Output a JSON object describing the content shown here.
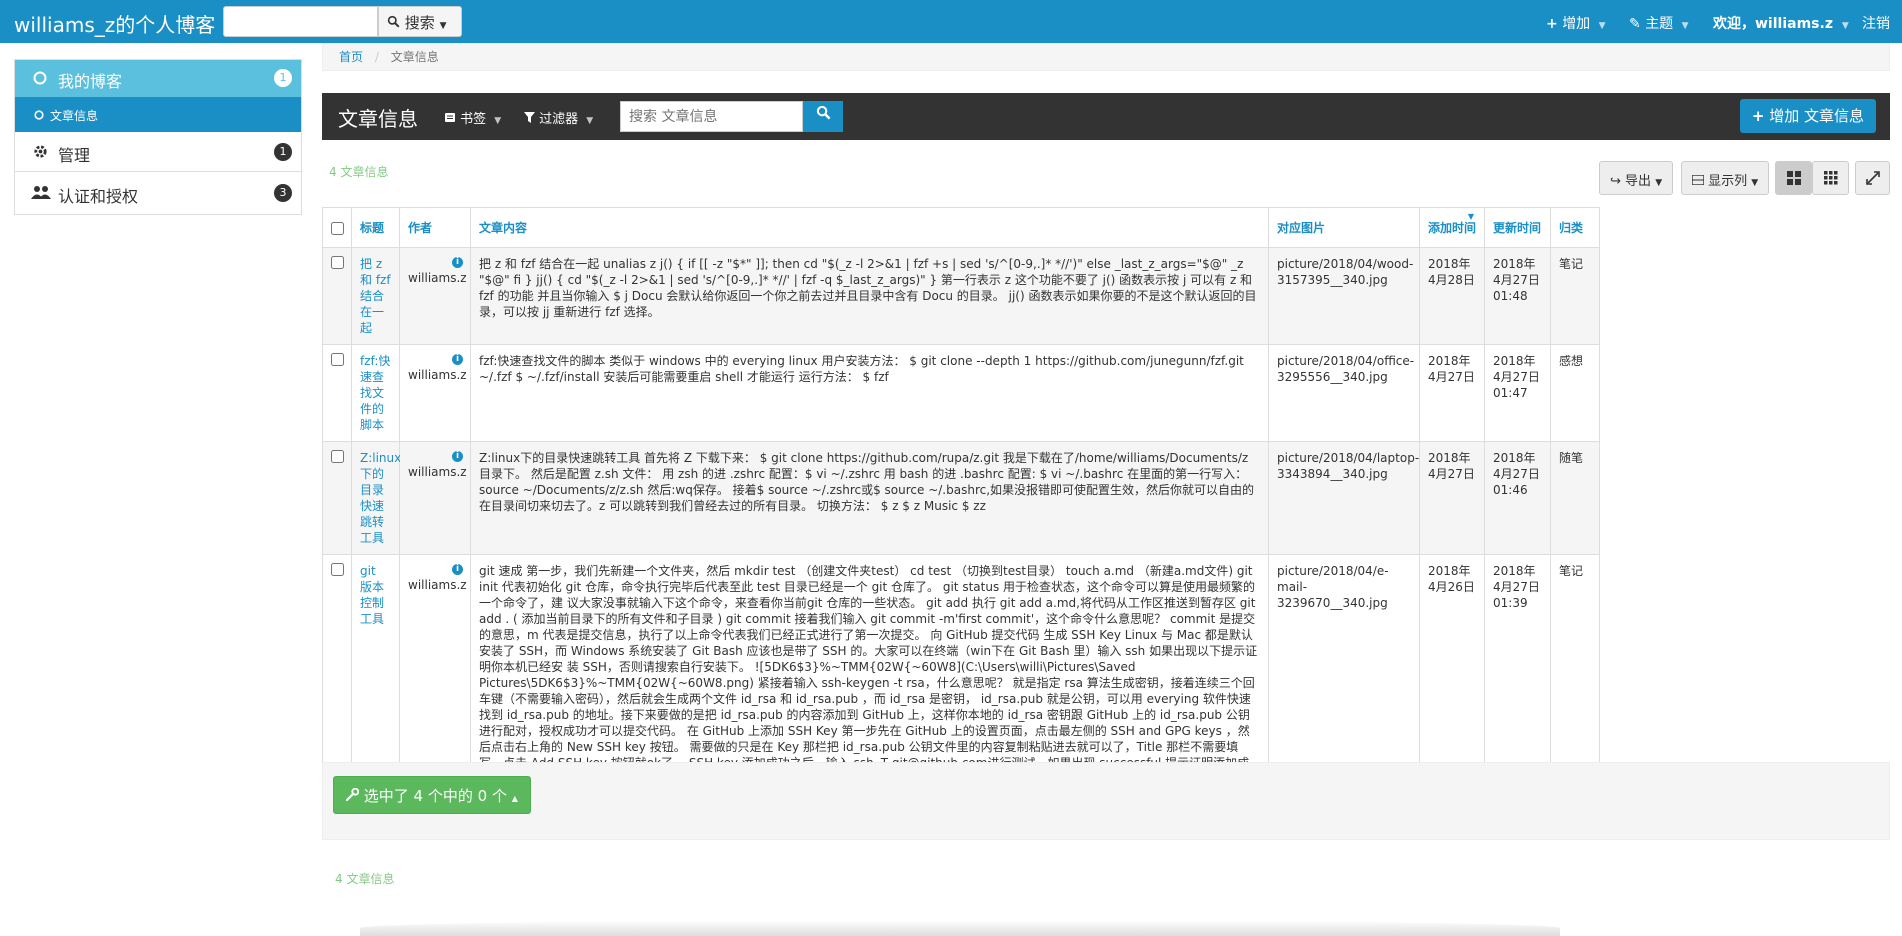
{
  "topbar": {
    "brand": "williams_z的个人博客",
    "search_placeholder": "",
    "search_button": "搜索",
    "add_menu": "增加",
    "theme_menu": "主题",
    "welcome": "欢迎，williams.z",
    "logout": "注销"
  },
  "sidebar": {
    "items": [
      {
        "label": "我的博客",
        "badge": "1"
      },
      {
        "label": "文章信息"
      },
      {
        "label": "管理",
        "badge": "1"
      },
      {
        "label": "认证和授权",
        "badge": "3"
      }
    ]
  },
  "breadcrumb": {
    "home": "首页",
    "sep": "/",
    "current": "文章信息"
  },
  "panel": {
    "title": "文章信息",
    "bookmark_menu": "书签",
    "filter_menu": "过滤器",
    "search_placeholder": "搜索 文章信息",
    "add_button": "增加 文章信息"
  },
  "toolbar": {
    "count_text": "4 文章信息",
    "export_button": "导出",
    "columns_button": "显示列"
  },
  "table": {
    "headers": [
      "标题",
      "作者",
      "文章内容",
      "对应图片",
      "添加时间",
      "更新时间",
      "归类"
    ],
    "rows": [
      {
        "title": "把 z 和 fzf 结合在一起",
        "author": "williams.z",
        "content": "把 z 和 fzf 结合在一起 unalias z j() { if [[ -z \"$*\" ]]; then cd \"$(_z -l 2>&1 | fzf +s | sed 's/^[0-9,.]* *//')\" else _last_z_args=\"$@\" _z \"$@\" fi } jj() { cd \"$(_z -l 2>&1 | sed 's/^[0-9,.]* *//' | fzf -q $_last_z_args)\" } 第一行表示 z 这个功能不要了 j() 函数表示按 j 可以有 z 和 fzf 的功能 并且当你输入 $ j Docu 会默认给你返回一个你之前去过并且目录中含有 Docu 的目录。 jj() 函数表示如果你要的不是这个默认返回的目录，可以按 jj 重新进行 fzf 选择。",
        "image": "picture/2018/04/wood-3157395__340.jpg",
        "added": "2018年4月28日",
        "updated": "2018年4月27日 01:48",
        "category": "笔记"
      },
      {
        "title": "fzf:快速查找文件的脚本",
        "author": "williams.z",
        "content": "fzf:快速查找文件的脚本 类似于 windows 中的 everying linux 用户安装方法：  $ git clone --depth 1 https://github.com/junegunn/fzf.git ~/.fzf $ ~/.fzf/install 安装后可能需要重启 shell 才能运行 运行方法：  $ fzf",
        "image": "picture/2018/04/office-3295556__340.jpg",
        "added": "2018年4月27日",
        "updated": "2018年4月27日 01:47",
        "category": "感想"
      },
      {
        "title": "Z:linux下的目录快速跳转工具",
        "author": "williams.z",
        "content": "Z:linux下的目录快速跳转工具 首先将 Z 下载下来：  $ git clone https://github.com/rupa/z.git 我是下载在了/home/williams/Documents/z目录下。 然后是配置 z.sh 文件：  用 zsh 的进 .zshrc 配置：$ vi ~/.zshrc 用 bash 的进 .bashrc 配置: $ vi ~/.bashrc  在里面的第一行写入：  source ~/Documents/z/z.sh 然后:wq保存。 接着$ source ~/.zshrc或$ source ~/.bashrc,如果没报错即可使配置生效，然后你就可以自由的在目录间切来切去了。z 可以跳转到我们曾经去过的所有目录。 切换方法：  $ z $ z Music $ zz",
        "image": "picture/2018/04/laptop-3343894__340.jpg",
        "added": "2018年4月27日",
        "updated": "2018年4月27日 01:46",
        "category": "随笔"
      },
      {
        "title": "git 版本控制工具",
        "author": "williams.z",
        "content": "git 速成 第一步，我们先新建一个文件夹，然后 mkdir test （创建文件夹test） cd test （切换到test目录） touch a.md （新建a.md文件) git init 代表初始化 git 仓库，命令执行完毕后代表至此 test 目录已经是一个 git 仓库了。 git status 用于检查状态，这个命令可以算是使用最频繁的一个命令了，建 议大家没事就输入下这个命令，来查看你当前git 仓库的一些状态。 git add 执行 git add a.md,将代码从工作区推送到暂存区 git add . ( 添加当前目录下的所有文件和子目录 ) git commit 接着我们输入 git commit -m'first commit'，这个命令什么意思呢？ commit 是提交的意思，m 代表是提交信息，执行了以上命令代表我们已经正式进行了第一次提交。 向 GitHub 提交代码 生成 SSH Key Linux 与 Mac 都是默认安装了 SSH，而 Windows 系统安装了 Git Bash 应该也是带了 SSH 的。大家可以在终端（win下在 Git Bash 里）输入 ssh 如果出现以下提示证明你本机已经安 装 SSH，否则请搜索自行安装下。 ![5DK6$3}%~TMM{02W{~60W8](C:\\Users\\willi\\Pictures\\Saved Pictures\\5DK6$3}%~TMM{02W{~60W8.png) 紧接着输入 ssh-keygen -t rsa，什么意思呢？ 就是指定 rsa 算法生成密钥，接着连续三个回 车键（不需要输入密码），然后就会生成两个文件 id_rsa 和 id_rsa.pub ，而 id_rsa 是密钥， id_rsa.pub 就是公钥，可以用 everying 软件快速找到 id_rsa.pub 的地址。接下来要做的是把 id_rsa.pub 的内容添加到 GitHub 上，这样你本地的 id_rsa 密钥跟 GitHub 上的 id_rsa.pub 公钥进行配对，授权成功才可以提交代码。 在 GitHub 上添加 SSH Key 第一步先在 GitHub 上的设置页面，点击最左侧的 SSH and GPG keys ，然后点击右上角的 New SSH key 按钮。 需要做的只是在 Key 那栏把 id_rsa.pub 公钥文件里的内容复制粘贴进去就可以了，Title 那栏不需要填写，点击 Add SSH key 按钮就ok了。 SSH key 添加成功之后，输入 ssh -T git@github.com进行测试，如果出现 successful 提示证明添加成功 配置用户名和邮箱 git config --global user.name \"WilliamsZhang\" git config --global user.email \"williams_z@yeah.net\" 提交代码 Clone自己的项目，以我在 GitHub 上创建的 test 项目为例 用git remote add origin git@github.com:WilliamsZhang/test.git git pull --rebase origin master git push origin master",
        "image": "picture/2018/04/e-mail-3239670__340.jpg",
        "added": "2018年4月26日",
        "updated": "2018年4月27日 01:39",
        "category": "笔记"
      }
    ]
  },
  "footer": {
    "selection_button": "选中了 4 个中的 0 个",
    "count_text": "4 文章信息"
  }
}
